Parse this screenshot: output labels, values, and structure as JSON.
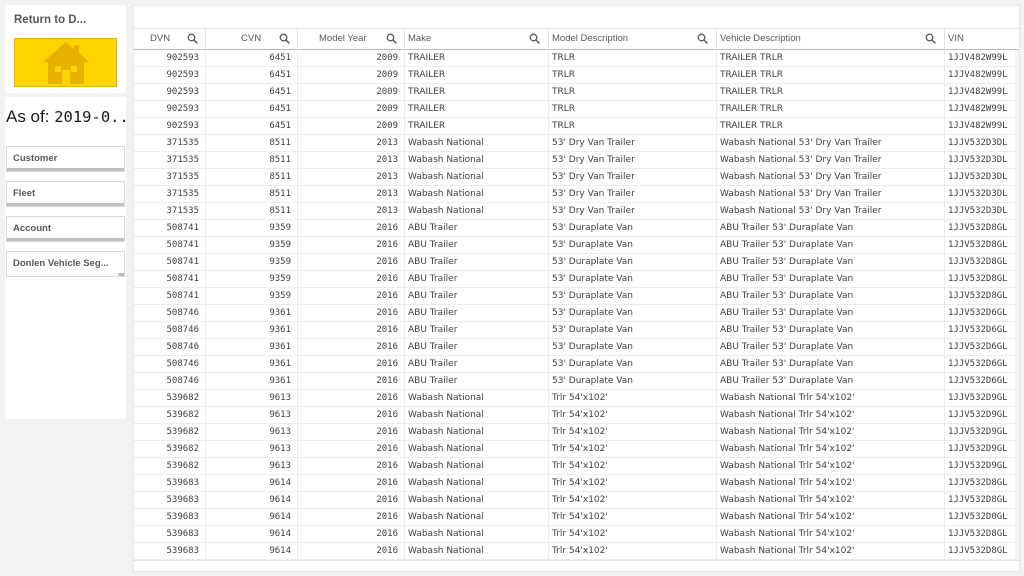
{
  "nav": {
    "return_label": "Return to D...",
    "home_icon": "house-icon"
  },
  "asof": {
    "prefix": "As of: ",
    "date": "2019-0..."
  },
  "filters": [
    "Customer",
    "Fleet",
    "Account",
    "Donlen Vehicle Seg..."
  ],
  "table": {
    "columns": [
      "DVN",
      "CVN",
      "Model Year",
      "Make",
      "Model Description",
      "Vehicle Description",
      "VIN"
    ],
    "rows": [
      [
        "902593",
        "6451",
        "2009",
        "TRAILER",
        "TRLR",
        "TRAILER TRLR",
        "1JJV482W99L"
      ],
      [
        "902593",
        "6451",
        "2009",
        "TRAILER",
        "TRLR",
        "TRAILER TRLR",
        "1JJV482W99L"
      ],
      [
        "902593",
        "6451",
        "2009",
        "TRAILER",
        "TRLR",
        "TRAILER TRLR",
        "1JJV482W99L"
      ],
      [
        "902593",
        "6451",
        "2009",
        "TRAILER",
        "TRLR",
        "TRAILER TRLR",
        "1JJV482W99L"
      ],
      [
        "902593",
        "6451",
        "2009",
        "TRAILER",
        "TRLR",
        "TRAILER TRLR",
        "1JJV482W99L"
      ],
      [
        "371535",
        "8511",
        "2013",
        "Wabash National",
        "53' Dry Van Trailer",
        "Wabash National 53' Dry Van Trailer",
        "1JJV532D3DL"
      ],
      [
        "371535",
        "8511",
        "2013",
        "Wabash National",
        "53' Dry Van Trailer",
        "Wabash National 53' Dry Van Trailer",
        "1JJV532D3DL"
      ],
      [
        "371535",
        "8511",
        "2013",
        "Wabash National",
        "53' Dry Van Trailer",
        "Wabash National 53' Dry Van Trailer",
        "1JJV532D3DL"
      ],
      [
        "371535",
        "8511",
        "2013",
        "Wabash National",
        "53' Dry Van Trailer",
        "Wabash National 53' Dry Van Trailer",
        "1JJV532D3DL"
      ],
      [
        "371535",
        "8511",
        "2013",
        "Wabash National",
        "53' Dry Van Trailer",
        "Wabash National 53' Dry Van Trailer",
        "1JJV532D3DL"
      ],
      [
        "508741",
        "9359",
        "2016",
        "ABU Trailer",
        "53' Duraplate Van",
        "ABU Trailer 53' Duraplate Van",
        "1JJV532D8GL"
      ],
      [
        "508741",
        "9359",
        "2016",
        "ABU Trailer",
        "53' Duraplate Van",
        "ABU Trailer 53' Duraplate Van",
        "1JJV532D8GL"
      ],
      [
        "508741",
        "9359",
        "2016",
        "ABU Trailer",
        "53' Duraplate Van",
        "ABU Trailer 53' Duraplate Van",
        "1JJV532D8GL"
      ],
      [
        "508741",
        "9359",
        "2016",
        "ABU Trailer",
        "53' Duraplate Van",
        "ABU Trailer 53' Duraplate Van",
        "1JJV532D8GL"
      ],
      [
        "508741",
        "9359",
        "2016",
        "ABU Trailer",
        "53' Duraplate Van",
        "ABU Trailer 53' Duraplate Van",
        "1JJV532D8GL"
      ],
      [
        "508746",
        "9361",
        "2016",
        "ABU Trailer",
        "53' Duraplate Van",
        "ABU Trailer 53' Duraplate Van",
        "1JJV532D6GL"
      ],
      [
        "508746",
        "9361",
        "2016",
        "ABU Trailer",
        "53' Duraplate Van",
        "ABU Trailer 53' Duraplate Van",
        "1JJV532D6GL"
      ],
      [
        "508746",
        "9361",
        "2016",
        "ABU Trailer",
        "53' Duraplate Van",
        "ABU Trailer 53' Duraplate Van",
        "1JJV532D6GL"
      ],
      [
        "508746",
        "9361",
        "2016",
        "ABU Trailer",
        "53' Duraplate Van",
        "ABU Trailer 53' Duraplate Van",
        "1JJV532D6GL"
      ],
      [
        "508746",
        "9361",
        "2016",
        "ABU Trailer",
        "53' Duraplate Van",
        "ABU Trailer 53' Duraplate Van",
        "1JJV532D6GL"
      ],
      [
        "539682",
        "9613",
        "2016",
        "Wabash National",
        "Trlr 54'x102'",
        "Wabash National Trlr 54'x102'",
        "1JJV532D9GL"
      ],
      [
        "539682",
        "9613",
        "2016",
        "Wabash National",
        "Trlr 54'x102'",
        "Wabash National Trlr 54'x102'",
        "1JJV532D9GL"
      ],
      [
        "539682",
        "9613",
        "2016",
        "Wabash National",
        "Trlr 54'x102'",
        "Wabash National Trlr 54'x102'",
        "1JJV532D9GL"
      ],
      [
        "539682",
        "9613",
        "2016",
        "Wabash National",
        "Trlr 54'x102'",
        "Wabash National Trlr 54'x102'",
        "1JJV532D9GL"
      ],
      [
        "539682",
        "9613",
        "2016",
        "Wabash National",
        "Trlr 54'x102'",
        "Wabash National Trlr 54'x102'",
        "1JJV532D9GL"
      ],
      [
        "539683",
        "9614",
        "2016",
        "Wabash National",
        "Trlr 54'x102'",
        "Wabash National Trlr 54'x102'",
        "1JJV532D8GL"
      ],
      [
        "539683",
        "9614",
        "2016",
        "Wabash National",
        "Trlr 54'x102'",
        "Wabash National Trlr 54'x102'",
        "1JJV532D8GL"
      ],
      [
        "539683",
        "9614",
        "2016",
        "Wabash National",
        "Trlr 54'x102'",
        "Wabash National Trlr 54'x102'",
        "1JJV532D0GL"
      ],
      [
        "539683",
        "9614",
        "2016",
        "Wabash National",
        "Trlr 54'x102'",
        "Wabash National Trlr 54'x102'",
        "1JJV532D8GL"
      ],
      [
        "539683",
        "9614",
        "2016",
        "Wabash National",
        "Trlr 54'x102'",
        "Wabash National Trlr 54'x102'",
        "1JJV532D8GL"
      ]
    ]
  },
  "colors": {
    "home_button": "#ffd400",
    "home_icon": "#e8b100"
  }
}
